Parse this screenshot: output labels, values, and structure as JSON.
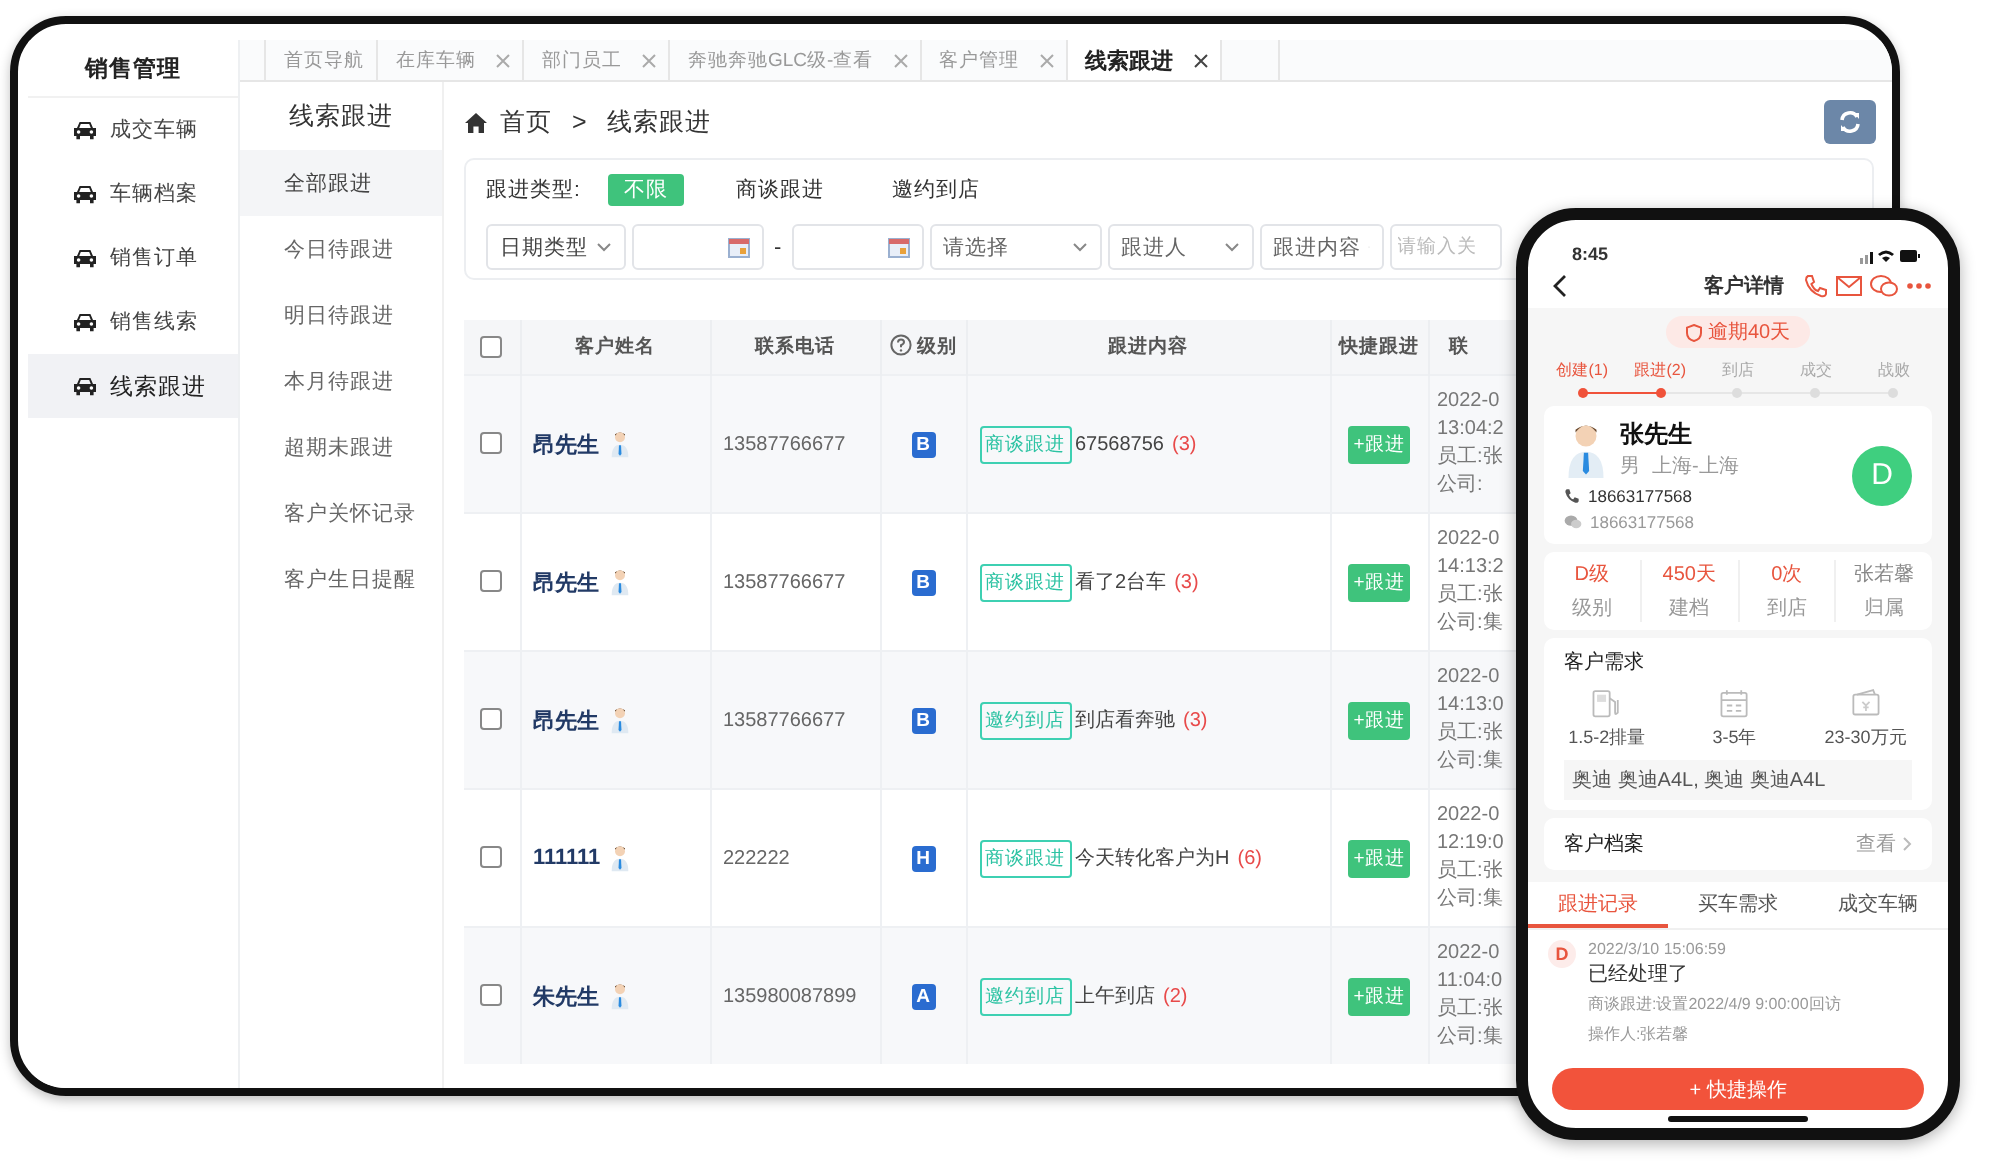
{
  "tablet": {
    "sidebar": {
      "title": "销售管理",
      "items": [
        {
          "label": "成交车辆",
          "selected": false
        },
        {
          "label": "车辆档案",
          "selected": false
        },
        {
          "label": "销售订单",
          "selected": false
        },
        {
          "label": "销售线索",
          "selected": false
        },
        {
          "label": "线索跟进",
          "selected": true
        }
      ]
    },
    "tabs": [
      {
        "label": "首页导航",
        "closable": false,
        "selected": false
      },
      {
        "label": "在库车辆",
        "closable": true,
        "selected": false
      },
      {
        "label": "部门员工",
        "closable": true,
        "selected": false
      },
      {
        "label": "奔驰奔驰GLC级-查看",
        "closable": true,
        "selected": false
      },
      {
        "label": "客户管理",
        "closable": true,
        "selected": false
      },
      {
        "label": "线索跟进",
        "closable": true,
        "selected": true
      }
    ],
    "subnav": {
      "title": "线索跟进",
      "items": [
        {
          "label": "全部跟进",
          "selected": true
        },
        {
          "label": "今日待跟进",
          "selected": false
        },
        {
          "label": "明日待跟进",
          "selected": false
        },
        {
          "label": "本月待跟进",
          "selected": false
        },
        {
          "label": "超期未跟进",
          "selected": false
        },
        {
          "label": "客户关怀记录",
          "selected": false
        },
        {
          "label": "客户生日提醒",
          "selected": false
        }
      ]
    },
    "breadcrumb": {
      "items": [
        "首页",
        "线索跟进"
      ],
      "separator": ">"
    },
    "filters": {
      "type_label": "跟进类型:",
      "type_options": [
        {
          "label": "不限",
          "selected": true
        },
        {
          "label": "商谈跟进",
          "selected": false
        },
        {
          "label": "邀约到店",
          "selected": false
        }
      ],
      "controls": [
        {
          "kind": "select",
          "value": "日期类型"
        },
        {
          "kind": "date"
        },
        {
          "kind": "dash",
          "text": "-"
        },
        {
          "kind": "date"
        },
        {
          "kind": "select",
          "placeholder": "请选择"
        },
        {
          "kind": "select",
          "placeholder": "跟进人"
        },
        {
          "kind": "select",
          "placeholder": "跟进内容"
        },
        {
          "kind": "input",
          "placeholder": "请输入关"
        }
      ]
    },
    "table": {
      "header_checked": false,
      "columns": [
        {
          "label": "客户姓名",
          "help": false
        },
        {
          "label": "联系电话",
          "help": false
        },
        {
          "label": "级别",
          "help": true
        },
        {
          "label": "跟进内容",
          "help": false
        },
        {
          "label": "快捷跟进",
          "help": false
        },
        {
          "label": "联",
          "help": false
        }
      ],
      "rows": [
        {
          "checked": false,
          "name": "昂先生",
          "phone": "13587766677",
          "level": "B",
          "tag": "商谈跟进",
          "content": "67568756",
          "count": "(3)",
          "action": "+跟进",
          "date": "2022-0",
          "time": "13:04:2",
          "staff": "员工:张",
          "company": "公司:"
        },
        {
          "checked": false,
          "name": "昂先生",
          "phone": "13587766677",
          "level": "B",
          "tag": "商谈跟进",
          "content": "看了2台车",
          "count": "(3)",
          "action": "+跟进",
          "date": "2022-0",
          "time": "14:13:2",
          "staff": "员工:张",
          "company": "公司:集"
        },
        {
          "checked": false,
          "name": "昂先生",
          "phone": "13587766677",
          "level": "B",
          "tag": "邀约到店",
          "content": "到店看奔驰",
          "count": "(3)",
          "action": "+跟进",
          "date": "2022-0",
          "time": "14:13:0",
          "staff": "员工:张",
          "company": "公司:集"
        },
        {
          "checked": false,
          "name": "111111",
          "phone": "222222",
          "level": "H",
          "tag": "商谈跟进",
          "content": "今天转化客户为H",
          "count": "(6)",
          "action": "+跟进",
          "date": "2022-0",
          "time": "12:19:0",
          "staff": "员工:张",
          "company": "公司:集"
        },
        {
          "checked": false,
          "name": "朱先生",
          "phone": "135980087899",
          "level": "A",
          "tag": "邀约到店",
          "content": "上午到店",
          "count": "(2)",
          "action": "+跟进",
          "date": "2022-0",
          "time": "11:04:0",
          "staff": "员工:张",
          "company": "公司:集"
        }
      ]
    }
  },
  "phone": {
    "time": "8:45",
    "title": "客户详情",
    "overdue": "逾期40天",
    "steps": [
      {
        "label": "创建(1)",
        "done": true
      },
      {
        "label": "跟进(2)",
        "done": true
      },
      {
        "label": "到店",
        "done": false
      },
      {
        "label": "成交",
        "done": false
      },
      {
        "label": "战败",
        "done": false
      }
    ],
    "customer": {
      "name": "张先生",
      "gender": "男",
      "region": "上海-上海",
      "phone": "18663177568",
      "wechat": "18663177568",
      "grade": "D"
    },
    "stats": [
      {
        "value": "D级",
        "label": "级别",
        "highlight": true
      },
      {
        "value": "450天",
        "label": "建档",
        "highlight": true
      },
      {
        "value": "0次",
        "label": "到店",
        "highlight": true
      },
      {
        "value": "张若馨",
        "label": "归属",
        "highlight": false
      }
    ],
    "needs": {
      "title": "客户需求",
      "items": [
        {
          "kind": "fuel",
          "text": "1.5-2排量"
        },
        {
          "kind": "calendar",
          "text": "3-5年"
        },
        {
          "kind": "wallet",
          "text": "23-30万元"
        }
      ],
      "models": "奥迪 奥迪A4L, 奥迪 奥迪A4L"
    },
    "archive": {
      "title": "客户档案",
      "link": "查看"
    },
    "tabs": [
      {
        "label": "跟进记录",
        "selected": true
      },
      {
        "label": "买车需求",
        "selected": false
      },
      {
        "label": "成交车辆",
        "selected": false
      }
    ],
    "records": [
      {
        "badge": "D",
        "time": "2022/3/10 15:06:59",
        "text": "已经处理了",
        "detail": "商谈跟进:设置2022/4/9 9:00:00回访",
        "operator": "操作人:张若馨"
      }
    ],
    "action": "+ 快捷操作"
  }
}
